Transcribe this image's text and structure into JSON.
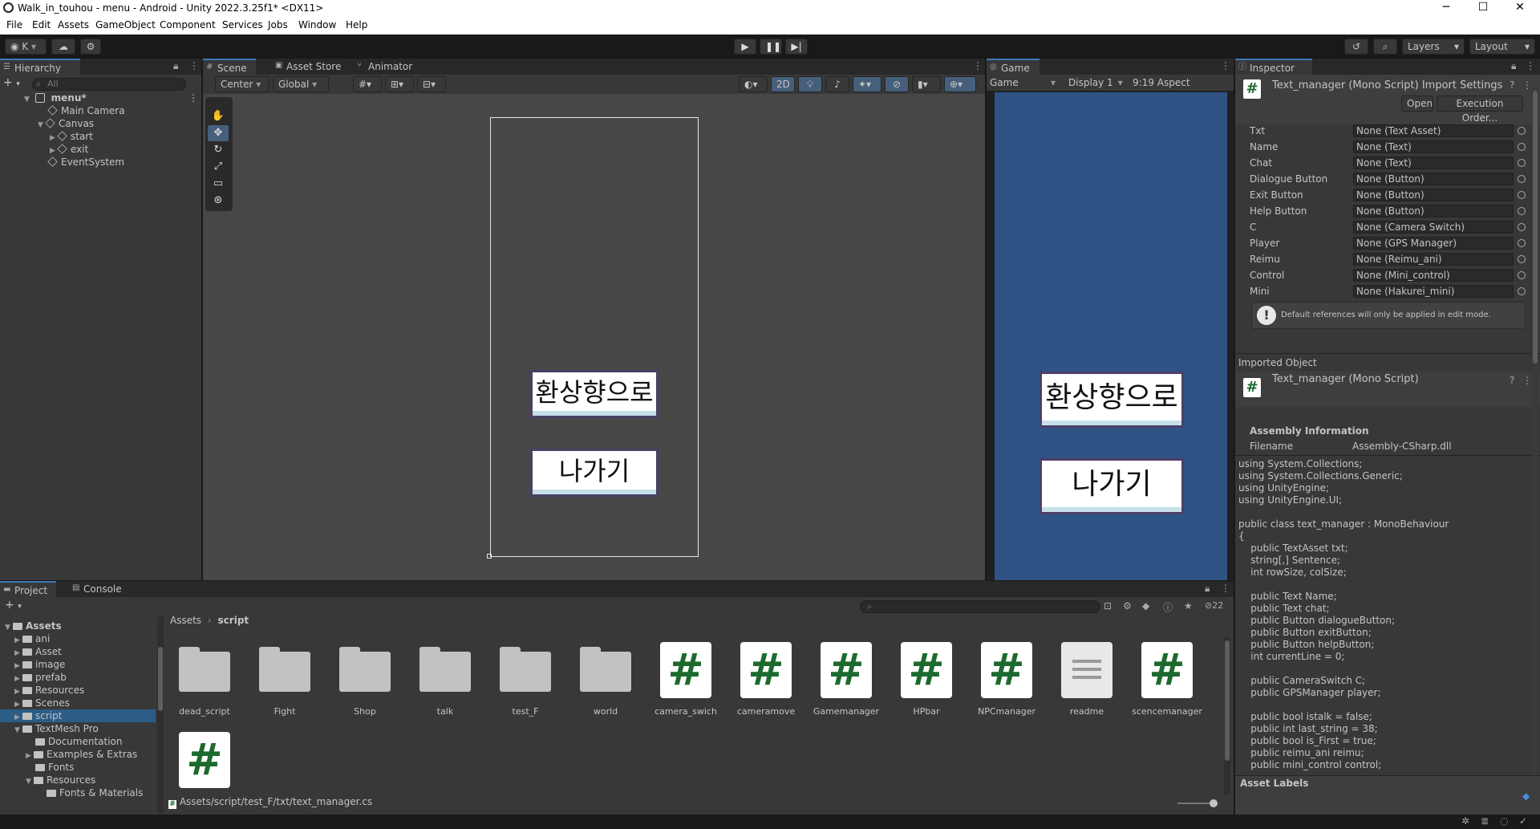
{
  "window": {
    "title": "Walk_in_touhou - menu - Android - Unity 2022.3.25f1* <DX11>",
    "controls": [
      "─",
      "☐",
      "✕"
    ]
  },
  "menu": [
    "File",
    "Edit",
    "Assets",
    "GameObject",
    "Component",
    "Services",
    "Jobs",
    "Window",
    "Help"
  ],
  "toolbar": {
    "account": "K",
    "layers": "Layers",
    "layout": "Layout"
  },
  "hierarchy": {
    "tab": "Hierarchy",
    "search_placeholder": "All",
    "scene": "menu*",
    "items": [
      "Main Camera",
      "Canvas",
      "start",
      "exit",
      "EventSystem"
    ]
  },
  "scene_view": {
    "tabs": [
      "Scene",
      "Asset Store",
      "Animator"
    ],
    "pivot": "Center",
    "space": "Global",
    "mode_2d": "2D",
    "buttons": [
      "환상향으로",
      "나가기"
    ]
  },
  "game_view": {
    "tab": "Game",
    "dropdown": "Game",
    "display": "Display 1",
    "aspect": "9:19 Aspect",
    "buttons": [
      "환상향으로",
      "나가기"
    ]
  },
  "inspector": {
    "tab": "Inspector",
    "header_title": "Text_manager (Mono Script) Import Settings",
    "open_button": "Open",
    "exec_order_button": "Execution Order...",
    "fields": [
      {
        "label": "Txt",
        "value": "None (Text Asset)"
      },
      {
        "label": "Name",
        "value": "None (Text)"
      },
      {
        "label": "Chat",
        "value": "None (Text)"
      },
      {
        "label": "Dialogue Button",
        "value": "None (Button)"
      },
      {
        "label": "Exit Button",
        "value": "None (Button)"
      },
      {
        "label": "Help Button",
        "value": "None (Button)"
      },
      {
        "label": "C",
        "value": "None (Camera Switch)"
      },
      {
        "label": "Player",
        "value": "None (GPS Manager)"
      },
      {
        "label": "Reimu",
        "value": "None (Reimu_ani)"
      },
      {
        "label": "Control",
        "value": "None (Mini_control)"
      },
      {
        "label": "Mini",
        "value": "None (Hakurei_mini)"
      }
    ],
    "info_message": "Default references will only be applied in edit mode.",
    "imported_object": "Imported Object",
    "imported_title": "Text_manager (Mono Script)",
    "assembly_header": "Assembly Information",
    "filename_label": "Filename",
    "filename_value": "Assembly-CSharp.dll",
    "code": [
      "using System.Collections;",
      "using System.Collections.Generic;",
      "using UnityEngine;",
      "using UnityEngine.UI;",
      "",
      "public class text_manager : MonoBehaviour",
      "{",
      "    public TextAsset txt;",
      "    string[,] Sentence;",
      "    int rowSize, colSize;",
      "",
      "    public Text Name;",
      "    public Text chat;",
      "    public Button dialogueButton;",
      "    public Button exitButton;",
      "    public Button helpButton;",
      "    int currentLine = 0;",
      "",
      "    public CameraSwitch C;",
      "    public GPSManager player;",
      "",
      "    public bool istalk = false;",
      "    public int last_string = 38;",
      "    public bool is_First = true;",
      "    public reimu_ani reimu;",
      "    public mini_control control;"
    ],
    "asset_labels": "Asset Labels"
  },
  "project": {
    "tabs": [
      "Project",
      "Console"
    ],
    "breadcrumb": [
      "Assets",
      "script"
    ],
    "hidden_count": "22",
    "tree": [
      {
        "label": "Assets",
        "depth": 0,
        "bold": true
      },
      {
        "label": "ani",
        "depth": 1
      },
      {
        "label": "Asset",
        "depth": 1
      },
      {
        "label": "image",
        "depth": 1
      },
      {
        "label": "prefab",
        "depth": 1
      },
      {
        "label": "Resources",
        "depth": 1
      },
      {
        "label": "Scenes",
        "depth": 1
      },
      {
        "label": "script",
        "depth": 1,
        "selected": true
      },
      {
        "label": "TextMesh Pro",
        "depth": 1
      },
      {
        "label": "Documentation",
        "depth": 2
      },
      {
        "label": "Examples & Extras",
        "depth": 2
      },
      {
        "label": "Fonts",
        "depth": 2
      },
      {
        "label": "Resources",
        "depth": 2
      },
      {
        "label": "Fonts & Materials",
        "depth": 3
      }
    ],
    "assets": [
      {
        "name": "dead_script",
        "kind": "folder"
      },
      {
        "name": "Fight",
        "kind": "folder"
      },
      {
        "name": "Shop",
        "kind": "folder"
      },
      {
        "name": "talk",
        "kind": "folder"
      },
      {
        "name": "test_F",
        "kind": "folder"
      },
      {
        "name": "world",
        "kind": "folder"
      },
      {
        "name": "camera_swich",
        "kind": "script"
      },
      {
        "name": "cameramove",
        "kind": "script"
      },
      {
        "name": "Gamemanager",
        "kind": "script"
      },
      {
        "name": "HPbar",
        "kind": "script"
      },
      {
        "name": "NPCmanager",
        "kind": "script"
      },
      {
        "name": "readme",
        "kind": "doc"
      },
      {
        "name": "scencemanager",
        "kind": "script"
      },
      {
        "name": "",
        "kind": "script"
      }
    ],
    "selected_path": "Assets/script/test_F/txt/text_manager.cs"
  }
}
